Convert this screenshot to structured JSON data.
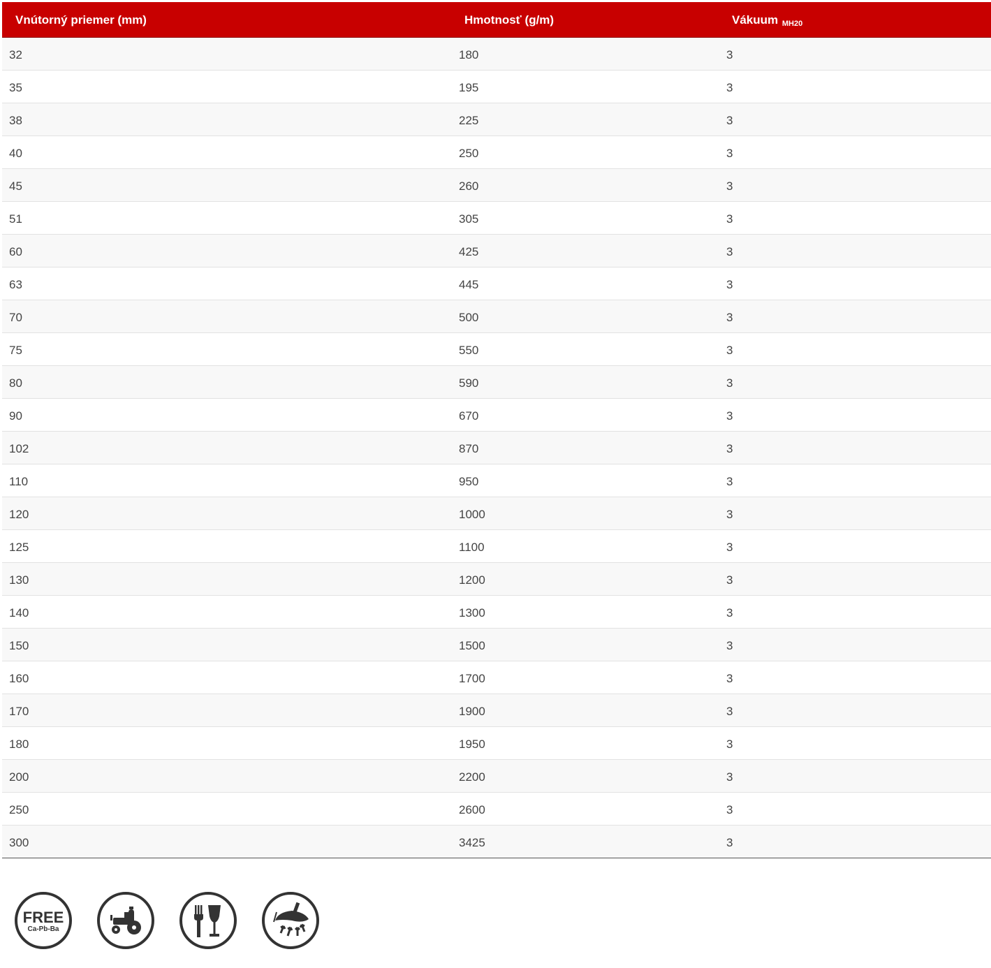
{
  "table": {
    "headers": {
      "diameter": "Vnútorný priemer (mm)",
      "weight": "Hmotnosť (g/m)",
      "vacuum": "Vákuum",
      "vacuum_unit": "MH20"
    },
    "rows": [
      [
        "32",
        "180",
        "3"
      ],
      [
        "35",
        "195",
        "3"
      ],
      [
        "38",
        "225",
        "3"
      ],
      [
        "40",
        "250",
        "3"
      ],
      [
        "45",
        "260",
        "3"
      ],
      [
        "51",
        "305",
        "3"
      ],
      [
        "60",
        "425",
        "3"
      ],
      [
        "63",
        "445",
        "3"
      ],
      [
        "70",
        "500",
        "3"
      ],
      [
        "75",
        "550",
        "3"
      ],
      [
        "80",
        "590",
        "3"
      ],
      [
        "90",
        "670",
        "3"
      ],
      [
        "102",
        "870",
        "3"
      ],
      [
        "110",
        "950",
        "3"
      ],
      [
        "120",
        "1000",
        "3"
      ],
      [
        "125",
        "1100",
        "3"
      ],
      [
        "130",
        "1200",
        "3"
      ],
      [
        "140",
        "1300",
        "3"
      ],
      [
        "150",
        "1500",
        "3"
      ],
      [
        "160",
        "1700",
        "3"
      ],
      [
        "170",
        "1900",
        "3"
      ],
      [
        "180",
        "1950",
        "3"
      ],
      [
        "200",
        "2200",
        "3"
      ],
      [
        "250",
        "2600",
        "3"
      ],
      [
        "300",
        "3425",
        "3"
      ]
    ]
  },
  "icons": {
    "free": {
      "name": "free-ca-pb-ba-icon",
      "line1": "FREE",
      "line2": "Ca-Pb-Ba"
    },
    "tractor": {
      "name": "agriculture-tractor-icon"
    },
    "food": {
      "name": "food-safe-icon"
    },
    "spray": {
      "name": "spray-nozzle-icon"
    }
  },
  "colors": {
    "header_bg": "#c80000",
    "header_text": "#ffffff",
    "text": "#444444",
    "row_alt": "#f8f8f8",
    "icon": "#333333"
  }
}
